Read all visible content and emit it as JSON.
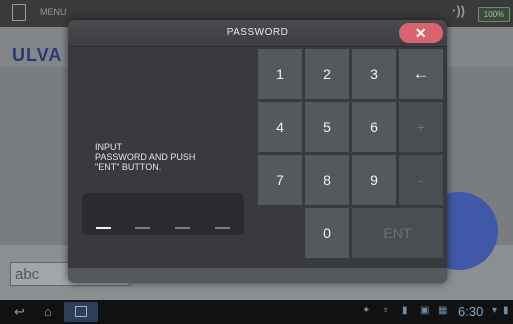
{
  "background_app": {
    "menu_label": "MENU",
    "battery_text": "100%",
    "logo_text": "ULVA",
    "input_mode_text": "abc"
  },
  "dialog": {
    "title": "PASSWORD",
    "close_label": "✕",
    "instruction": "INPUT\nPASSWORD AND PUSH\n\"ENT\" BUTTON.",
    "password_slots": 4,
    "filled_slots": 1
  },
  "keypad": {
    "k1": "1",
    "k2": "2",
    "k3": "3",
    "backspace": "←",
    "k4": "4",
    "k5": "5",
    "k6": "6",
    "plus": "+",
    "k7": "7",
    "k8": "8",
    "k9": "9",
    "minus": "-",
    "k0": "0",
    "ent": "ENT"
  },
  "system_bar": {
    "clock": "6:30"
  },
  "colors": {
    "close_button": "#d9646e",
    "dialog_bg": "#383a3d",
    "key_bg": "#55585c",
    "accent_circle": "#3f58a7"
  }
}
